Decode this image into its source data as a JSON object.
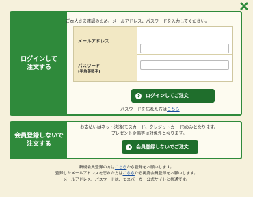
{
  "close_icon": "close-x-icon",
  "accent_color": "#2f8a3b",
  "login": {
    "side_title_line1": "ログインして",
    "side_title_line2": "注文する",
    "intro": "ご本人さま確認のため、メールアドレス、パスワードを入力してください。",
    "email_label": "メールアドレス",
    "email_value": "",
    "password_label": "パスワード",
    "password_sub": "(半角英数字)",
    "password_value": "",
    "button_label": "ログインしてご注文",
    "forgot_text": "パスワードを忘れた方は",
    "forgot_link": "こちら"
  },
  "guest": {
    "side_title_line1": "会員登録しないで",
    "side_title_line2": "注文する",
    "note_line1": "お支払いはネット決済(モスカード、クレジットカード)のみとなります。",
    "note_line2": "プレゼント企画等は対象外となります。",
    "button_label": "会員登録しないでご注文"
  },
  "footer": {
    "line1_pre": "新規会員登録の方は",
    "line1_link": "こちら",
    "line1_post": "から登録をお願いします。",
    "line2_pre": "登録したメールアドレスを忘れた方は",
    "line2_link": "こちら",
    "line2_post": "から再度会員登録をお願いします。",
    "line3": "メールアドレス、パスワードは、モスバーガー公式サイトと共通です。"
  }
}
